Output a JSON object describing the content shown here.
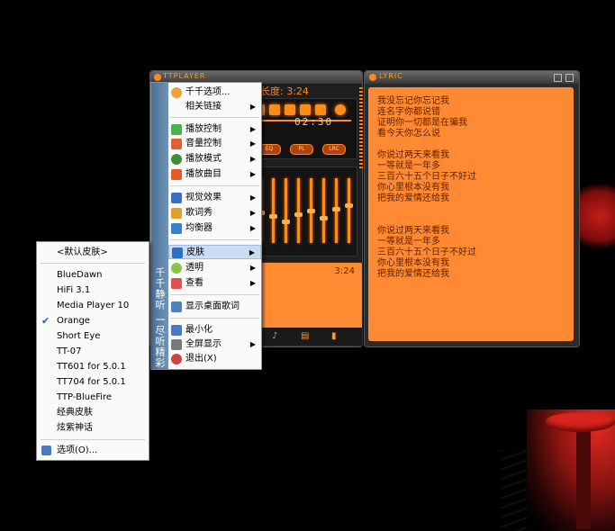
{
  "player": {
    "title": "TTPLAYER",
    "time_label": "长度: 3:24",
    "elapsed": "02:30",
    "pill_labels": [
      "EQ",
      "PL",
      "LRC"
    ],
    "playlist_time": "3:24",
    "banner_text": "千千静听 一尽听精彩"
  },
  "lyrics_window": {
    "title": "LYRIC",
    "lines": [
      "我没忘记你忘记我",
      "连名字你都说错",
      "证明你一切都是在骗我",
      "看今天你怎么说",
      "",
      "你说过两天来看我",
      "一等就是一年多",
      "三百六十五个日子不好过",
      "你心里根本没有我",
      "把我的爱情还给我",
      "",
      "",
      "你说过两天来看我",
      "一等就是一年多",
      "三百六十五个日子不好过",
      "你心里根本没有我",
      "把我的爱情还给我"
    ]
  },
  "main_menu": {
    "items": [
      {
        "label": "千千选项...",
        "submenu": false,
        "icon": "options-icon",
        "color": "#f2a23a"
      },
      {
        "label": "相关链接",
        "submenu": true,
        "icon": "none",
        "color": ""
      },
      {
        "label": "播放控制",
        "submenu": true,
        "icon": "play-control-icon",
        "color": "#4caf50"
      },
      {
        "label": "音量控制",
        "submenu": true,
        "icon": "volume-icon",
        "color": "#e06030"
      },
      {
        "label": "播放模式",
        "submenu": true,
        "icon": "play-mode-icon",
        "color": "#3a8f3a"
      },
      {
        "label": "播放曲目",
        "submenu": true,
        "icon": "track-icon",
        "color": "#e65a2a"
      },
      {
        "label": "视觉效果",
        "submenu": true,
        "icon": "visual-icon",
        "color": "#3a6fc9"
      },
      {
        "label": "歌词秀",
        "submenu": true,
        "icon": "lyrics-icon",
        "color": "#e0a030"
      },
      {
        "label": "均衡器",
        "submenu": true,
        "icon": "equalizer-icon",
        "color": "#3a80d0"
      },
      {
        "label": "皮肤",
        "submenu": true,
        "icon": "skin-icon",
        "color": "#2d6fc2"
      },
      {
        "label": "透明",
        "submenu": true,
        "icon": "transparency-icon",
        "color": "#8bc34a"
      },
      {
        "label": "查看",
        "submenu": true,
        "icon": "view-icon",
        "color": "#e05050"
      },
      {
        "label": "显示桌面歌词",
        "submenu": false,
        "icon": "desktop-lyrics-icon",
        "color": "#5080c0"
      },
      {
        "label": "最小化",
        "submenu": false,
        "icon": "minimize-icon",
        "color": "#4a78c4"
      },
      {
        "label": "全屏显示",
        "submenu": true,
        "icon": "fullscreen-icon",
        "color": "#7a7a7a"
      },
      {
        "label": "退出(X)",
        "submenu": false,
        "icon": "exit-icon",
        "color": "#d04040"
      }
    ]
  },
  "skin_menu": {
    "items": [
      {
        "label": "<默认皮肤>",
        "checked": false
      },
      {
        "label": "BlueDawn",
        "checked": false
      },
      {
        "label": "HiFi 3.1",
        "checked": false
      },
      {
        "label": "Media Player 10",
        "checked": false
      },
      {
        "label": "Orange",
        "checked": true
      },
      {
        "label": "Short Eye",
        "checked": false
      },
      {
        "label": "TT-07",
        "checked": false
      },
      {
        "label": "TT601 for 5.0.1",
        "checked": false
      },
      {
        "label": "TT704 for 5.0.1",
        "checked": false
      },
      {
        "label": "TTP-BlueFire",
        "checked": false
      },
      {
        "label": "经典皮肤",
        "checked": false
      },
      {
        "label": "炫紫神话",
        "checked": false
      }
    ],
    "options_label": "选项(O)..."
  },
  "colors": {
    "accent": "#ff8c1a",
    "lyrics_bg": "#ff8a33",
    "menu_highlight": "#c9dcf2"
  }
}
